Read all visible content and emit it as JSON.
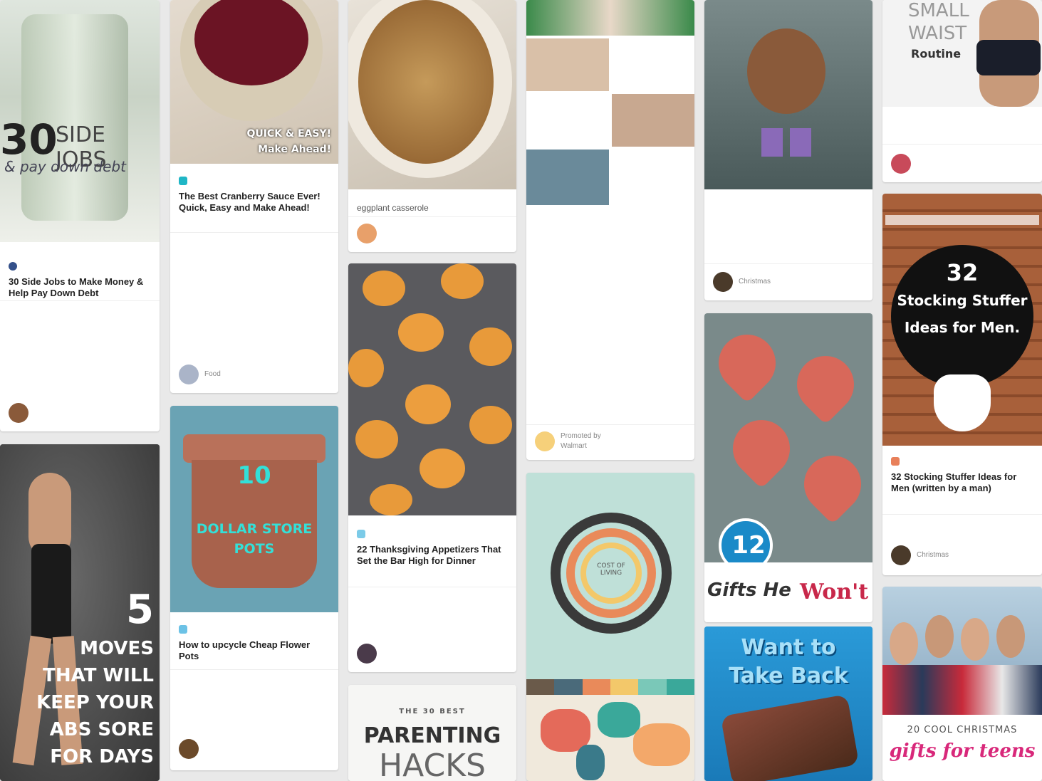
{
  "pins": {
    "side_jobs": {
      "overlay_num": "30",
      "overlay_big": "SIDE JOBS",
      "overlay_script": "& pay down debt",
      "title": "30 Side Jobs to Make Money & Help Pay Down Debt",
      "desc": "",
      "user": "",
      "board": ""
    },
    "five_moves": {
      "overlay_num": "5",
      "overlay_lines": [
        "MOVES",
        "THAT WILL",
        "KEEP YOUR",
        "ABS SORE",
        "FOR DAYS"
      ]
    },
    "cranberry": {
      "overlay": "QUICK & EASY!",
      "overlay2": "Make Ahead!",
      "title": "The Best Cranberry Sauce Ever! Quick, Easy and Make Ahead!",
      "desc": "",
      "user": "",
      "board": "Food"
    },
    "flower_pots": {
      "overlay_num": "10",
      "overlay_mid": "",
      "overlay_big": "DOLLAR STORE",
      "overlay_last": "POTS",
      "title": "How to upcycle Cheap Flower Pots",
      "desc": "",
      "user": "",
      "board": ""
    },
    "eggplant": {
      "title": "eggplant casserole",
      "user": "",
      "board": ""
    },
    "appetizers": {
      "title": "22 Thanksgiving Appetizers That Set the Bar High for Dinner",
      "desc": "",
      "user": "",
      "board": ""
    },
    "parenting": {
      "small": "THE 30 BEST",
      "big1": "PARENTING",
      "big2": "HACKS"
    },
    "gingerbread": {
      "tiles": [
        "",
        "",
        ""
      ],
      "desc": "",
      "promoted": "Promoted by",
      "brand": "Walmart"
    },
    "cost_of_living": {
      "ring": "COST OF LIVING"
    },
    "stocking_him": {
      "overlay": "",
      "desc": "",
      "user": "",
      "board": "Christmas"
    },
    "gifts_won_t": {
      "num": "12",
      "line1": "Gifts He",
      "line2": "Won't"
    },
    "take_back": {
      "line1": "Want to",
      "line2": "Take Back"
    },
    "small_waist": {
      "line1": "SMALL",
      "line2": "WAIST",
      "line3": "Routine",
      "title": "",
      "user": "",
      "board": ""
    },
    "stocking_men": {
      "num": "32",
      "line1": "Stocking Stuffer",
      "line2": "Ideas for Men.",
      "line3": "",
      "title": "32 Stocking Stuffer Ideas for Men (written by a man)",
      "user": "",
      "board": "Christmas"
    },
    "teens": {
      "line1": "20 COOL CHRISTMAS",
      "line2": "gifts for teens"
    }
  }
}
